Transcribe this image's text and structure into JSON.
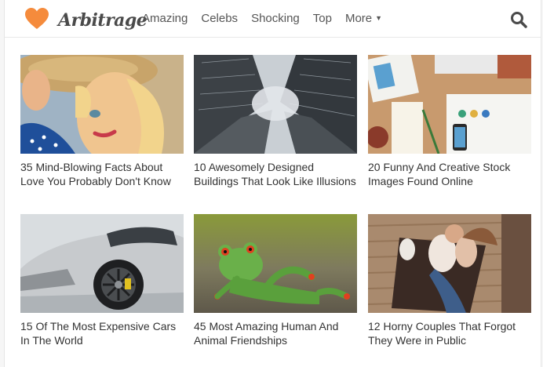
{
  "brand": {
    "name": "Arbitrage",
    "accent": "#f58b3c"
  },
  "nav": {
    "items": [
      "Amazing",
      "Celebs",
      "Shocking",
      "Top"
    ],
    "more_label": "More",
    "search_icon": "search-icon"
  },
  "articles": [
    {
      "title": "35 Mind-Blowing Facts About Love You Probably Don't Know",
      "image": "woman-with-straw-hat"
    },
    {
      "title": "10 Awesomely Designed Buildings That Look Like Illusions",
      "image": "skyscrapers-looking-up"
    },
    {
      "title": "20 Funny And Creative Stock Images Found Online",
      "image": "desk-flat-lay"
    },
    {
      "title": "15 Of The Most Expensive Cars In The World",
      "image": "silver-sports-car"
    },
    {
      "title": "45 Most Amazing Human And Animal Friendships",
      "image": "toy-frog-lounging"
    },
    {
      "title": "12 Horny Couples That Forgot They Were in Public",
      "image": "couple-on-blanket"
    }
  ]
}
